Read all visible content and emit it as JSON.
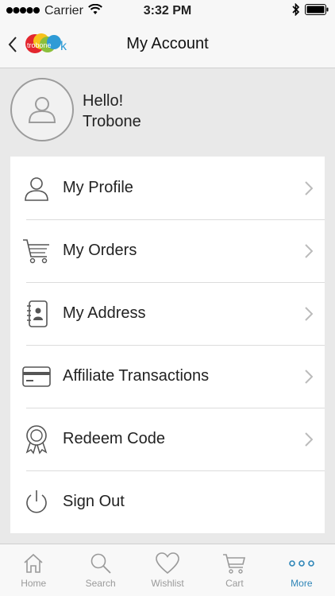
{
  "status": {
    "carrier": "Carrier",
    "time": "3:32 PM"
  },
  "nav": {
    "title": "My Account",
    "logo_text": "trobone",
    "logo_suffix": "k"
  },
  "greeting": {
    "hello": "Hello!",
    "name": "Trobone"
  },
  "menu": {
    "items": [
      {
        "label": "My Profile",
        "icon": "user-icon",
        "has_chevron": true
      },
      {
        "label": "My Orders",
        "icon": "cart-icon",
        "has_chevron": true
      },
      {
        "label": "My Address",
        "icon": "address-book-icon",
        "has_chevron": true
      },
      {
        "label": "Affiliate Transactions",
        "icon": "credit-card-icon",
        "has_chevron": true
      },
      {
        "label": "Redeem Code",
        "icon": "badge-icon",
        "has_chevron": true
      },
      {
        "label": "Sign Out",
        "icon": "power-icon",
        "has_chevron": false
      }
    ]
  },
  "tabs": [
    {
      "label": "Home",
      "icon": "home-icon",
      "active": false
    },
    {
      "label": "Search",
      "icon": "search-icon",
      "active": false
    },
    {
      "label": "Wishlist",
      "icon": "heart-icon",
      "active": false
    },
    {
      "label": "Cart",
      "icon": "cart-icon",
      "active": false
    },
    {
      "label": "More",
      "icon": "more-icon",
      "active": true
    }
  ],
  "colors": {
    "accent": "#2f86b8",
    "inactive": "#9a9a9a",
    "background": "#e9e9e9"
  }
}
